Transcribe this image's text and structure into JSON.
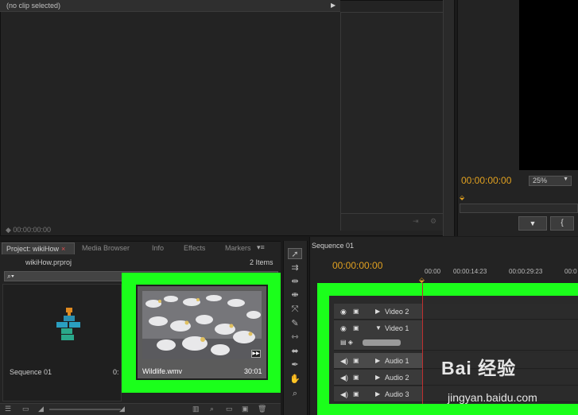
{
  "source_monitor": {
    "tab_label": "(no clip selected)",
    "timecode": "00:00:00:00"
  },
  "program_monitor": {
    "timecode": "00:00:00:00",
    "zoom": "25%",
    "button_2": "{"
  },
  "project_panel": {
    "tabs": [
      "Project: wikiHow",
      "Media Browser",
      "Info",
      "Effects",
      "Markers"
    ],
    "close_glyph": "×",
    "menu_glyph": "▾≡",
    "filename": "wikiHow.prproj",
    "item_count": "2 Items",
    "sequence_label": "Sequence 01",
    "sequence_duration_partial": "0:",
    "clip_name": "Wildlife.wmv",
    "clip_duration": "30:01"
  },
  "timeline": {
    "tab_label": "Sequence 01",
    "timecode": "00:00:00:00",
    "ruler_ticks": [
      "00:00",
      "00:00:14:23",
      "00:00:29:23",
      "00:0"
    ],
    "tracks": [
      "Video 2",
      "Video 1",
      "Audio 1",
      "Audio 2",
      "Audio 3"
    ]
  },
  "watermark": {
    "brand": "Bai 经验",
    "url": "jingyan.baidu.com"
  },
  "colors": {
    "highlight": "#1bff1b",
    "timecode": "#e0a020"
  },
  "icons": {
    "tools": [
      "selection-tool-icon",
      "track-select-icon",
      "ripple-edit-icon",
      "rolling-edit-icon",
      "rate-stretch-icon",
      "razor-icon",
      "slip-icon",
      "slide-icon",
      "pen-icon",
      "hand-icon",
      "zoom-icon"
    ]
  }
}
